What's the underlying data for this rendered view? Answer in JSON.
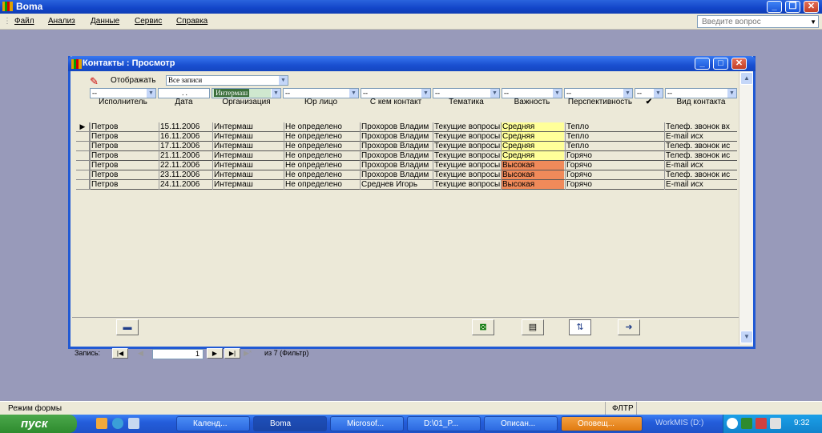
{
  "app": {
    "title": "Вoma"
  },
  "menu": [
    "Файл",
    "Анализ",
    "Данные",
    "Сервис",
    "Справка"
  ],
  "ask_placeholder": "Введите вопрос",
  "window": {
    "title": "Контакты : Просмотр"
  },
  "filter": {
    "label": "Отображать",
    "value": "Все записи",
    "date": ". .",
    "org": "Интермаш",
    "empty": "--"
  },
  "columns": [
    "Исполнитель",
    "Дата",
    "Организация",
    "Юр лицо",
    "С кем контакт",
    "Тематика",
    "Важность",
    "Перспективность",
    "✔",
    "Вид контакта"
  ],
  "rows": [
    [
      "Петров",
      "15.11.2006",
      "Интермаш",
      "Не определено",
      "Прохоров Владим",
      "Текущие вопросы",
      "Средняя",
      "Тепло",
      "Телеф. звонок вх"
    ],
    [
      "Петров",
      "16.11.2006",
      "Интермаш",
      "Не определено",
      "Прохоров Владим",
      "Текущие вопросы",
      "Средняя",
      "Тепло",
      "E-mail исх"
    ],
    [
      "Петров",
      "17.11.2006",
      "Интермаш",
      "Не определено",
      "Прохоров Владим",
      "Текущие вопросы",
      "Средняя",
      "Тепло",
      "Телеф. звонок ис"
    ],
    [
      "Петров",
      "21.11.2006",
      "Интермаш",
      "Не определено",
      "Прохоров Владим",
      "Текущие вопросы",
      "Средняя",
      "Горячо",
      "Телеф. звонок ис"
    ],
    [
      "Петров",
      "22.11.2006",
      "Интермаш",
      "Не определено",
      "Прохоров Владим",
      "Текущие вопросы",
      "Высокая",
      "Горячо",
      "E-mail исх"
    ],
    [
      "Петров",
      "23.11.2006",
      "Интермаш",
      "Не определено",
      "Прохоров Владим",
      "Текущие вопросы",
      "Высокая",
      "Горячо",
      "Телеф. звонок ис"
    ],
    [
      "Петров",
      "24.11.2006",
      "Интермаш",
      "Не определено",
      "Среднев Игорь",
      "Текущие вопросы",
      "Высокая",
      "Горячо",
      "E-mail исх"
    ]
  ],
  "colors": {
    "medium": "#ffff99",
    "high": "#f08a5a"
  },
  "nav": {
    "label": "Запись:",
    "current": "1",
    "total": "из 7 (Фильтр)"
  },
  "status": {
    "left": "Режим формы",
    "right": "ФЛТР"
  },
  "taskbar": {
    "start": "пуск",
    "items": [
      "Календ...",
      "Вoma",
      "Microsof...",
      "D:\\01_P...",
      "Описан...",
      "Оповещ...",
      "WorkMIS (D:)"
    ],
    "clock": "9:32"
  }
}
